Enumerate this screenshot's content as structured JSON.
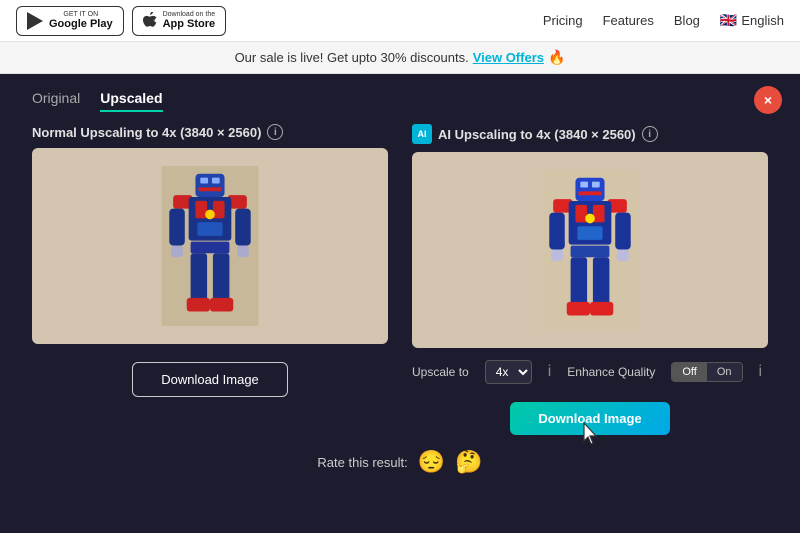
{
  "nav": {
    "google_play_small": "GET IT ON",
    "google_play_big": "Google Play",
    "app_store_small": "Download on the",
    "app_store_big": "App Store",
    "links": [
      "Pricing",
      "Features",
      "Blog"
    ],
    "lang": "English"
  },
  "banner": {
    "text": "Our sale is live! Get upto 30% discounts.",
    "link_text": "View Offers",
    "fire": "🔥"
  },
  "tabs": {
    "items": [
      "Original",
      "Upscaled"
    ],
    "active": "Upscaled"
  },
  "left_panel": {
    "label": "Normal Upscaling to 4x (3840 × 2560)",
    "download_btn": "Download Image"
  },
  "right_panel": {
    "label": "AI Upscaling to 4x (3840 × 2560)",
    "upscale_label": "Upscale to",
    "upscale_value": "4x",
    "enhance_label": "Enhance Quality",
    "toggle_off": "Off",
    "toggle_on": "On",
    "download_btn": "Download Image"
  },
  "rating": {
    "label": "Rate this result:",
    "sad_emoji": "😔",
    "neutral_emoji": "🤔"
  },
  "close_btn": "×"
}
